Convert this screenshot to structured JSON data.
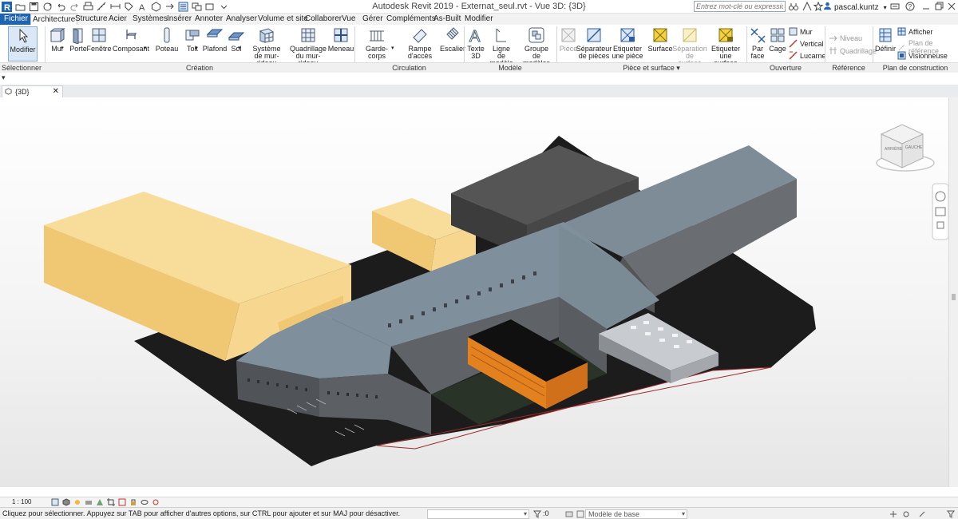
{
  "window": {
    "title": "Autodesk Revit 2019 - Externat_seul.rvt - Vue 3D: {3D}",
    "search_placeholder": "Entrez mot-clé ou expression",
    "username": "pascal.kuntz"
  },
  "tabs": [
    "Fichier",
    "Architecture",
    "Structure",
    "Acier",
    "Systèmes",
    "Insérer",
    "Annoter",
    "Analyser",
    "Volume et site",
    "Collaborer",
    "Vue",
    "Gérer",
    "Compléments",
    "As-Built",
    "Modifier"
  ],
  "active_tab": "Architecture",
  "ribbon": {
    "tools": {
      "modifier": "Modifier",
      "mur": "Mur",
      "porte": "Porte",
      "fenetre": "Fenêtre",
      "composant": "Composant",
      "poteau": "Poteau",
      "toit": "Toit",
      "plafond": "Plafond",
      "sol": "Sol",
      "systeme_1": "Système",
      "systeme_2": "de mur-rideau",
      "quadrillage_1": "Quadrillage",
      "quadrillage_2": "du mur-rideau",
      "meneau": "Meneau",
      "gardecorps": "Garde-corps",
      "rampe": "Rampe d'accès",
      "escalier": "Escalier",
      "texte_1": "Texte",
      "texte_2": "3D",
      "ligne_1": "Ligne",
      "ligne_2": "de modèle",
      "groupe_1": "Groupe",
      "groupe_2": "de modèles",
      "piece": "Pièce",
      "separateur_1": "Séparateur",
      "separateur_2": "de pièces",
      "etiq_piece_1": "Etiqueter",
      "etiq_piece_2": "une pièce",
      "surface": "Surface",
      "sep_surface_1": "Séparation",
      "sep_surface_2": "de surface",
      "etiq_surface_1": "Etiqueter",
      "etiq_surface_2": "une surface",
      "par_face_1": "Par",
      "par_face_2": "face",
      "cage": "Cage",
      "mur_small": "Mur",
      "vertical": "Vertical",
      "lucarne": "Lucarne",
      "niveau": "Niveau",
      "quadrillage_ref": "Quadrillage",
      "definir": "Définir",
      "afficher": "Afficher",
      "plan_de_reference": "Plan de référence",
      "visionneuse": "Visionneuse"
    },
    "panels": {
      "selectionner": "Sélectionner",
      "creation": "Création",
      "circulation": "Circulation",
      "modele": "Modèle",
      "piece_surface": "Pièce et surface",
      "ouverture": "Ouverture",
      "reference": "Référence",
      "plan_construction": "Plan de construction"
    }
  },
  "view_tab": {
    "label": "{3D}",
    "close": "✕"
  },
  "viewcube": {
    "face_left": "ARRIÈRE",
    "face_right": "GAUCHE"
  },
  "view_bar": {
    "scale": "1 : 100"
  },
  "status_bar": {
    "message": "Cliquez pour sélectionner. Appuyez sur TAB pour afficher d'autres options, sur CTRL pour ajouter et sur MAJ pour désactiver.",
    "count": ":0",
    "model": "Modèle de base"
  },
  "colors": {
    "file_tab": "#1e64b4",
    "mass": "#f4d486",
    "roof": "#7c8c96",
    "wall": "#5a5d62",
    "orange_building": "#e4811f",
    "site": "#1b1b1b"
  }
}
